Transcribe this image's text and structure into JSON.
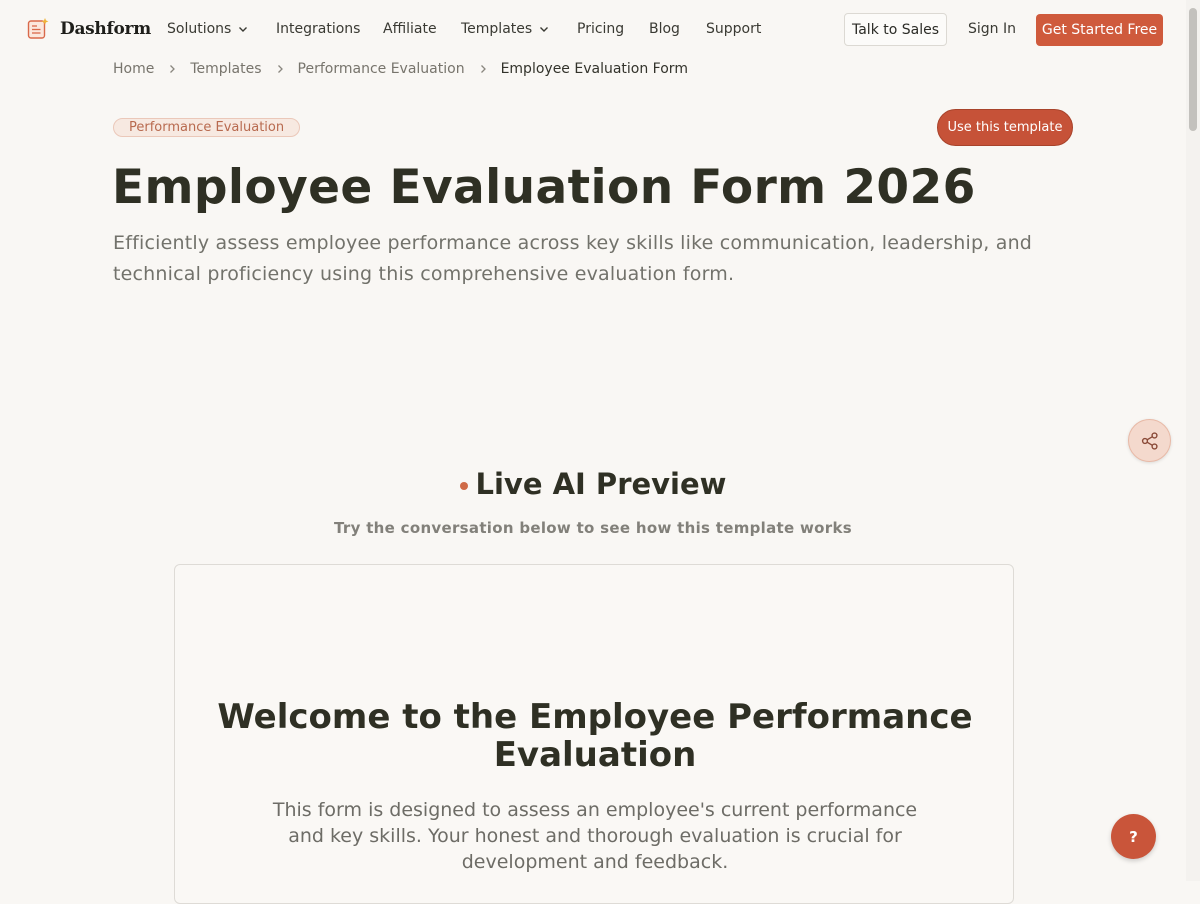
{
  "brand": {
    "name": "Dashform",
    "logo_icon": "form-sparkle-icon"
  },
  "nav": {
    "items": [
      {
        "label": "Solutions",
        "has_dropdown": true
      },
      {
        "label": "Integrations",
        "has_dropdown": false
      },
      {
        "label": "Affiliate",
        "has_dropdown": false
      },
      {
        "label": "Templates",
        "has_dropdown": true
      },
      {
        "label": "Pricing",
        "has_dropdown": false
      },
      {
        "label": "Blog",
        "has_dropdown": false
      },
      {
        "label": "Support",
        "has_dropdown": false
      }
    ],
    "talk_to_sales": "Talk to Sales",
    "sign_in": "Sign In",
    "get_started": "Get Started Free"
  },
  "breadcrumb": [
    "Home",
    "Templates",
    "Performance Evaluation",
    "Employee Evaluation Form"
  ],
  "hero": {
    "category_tag": "Performance Evaluation",
    "use_template": "Use this template",
    "title": "Employee Evaluation Form 2026",
    "description": "Efficiently assess employee performance across key skills like communication, leadership, and technical proficiency using this comprehensive evaluation form."
  },
  "preview": {
    "title": "Live AI Preview",
    "subtitle": "Try the conversation below to see how this template works",
    "welcome_title": "Welcome to the Employee Performance Evaluation",
    "welcome_description": "This form is designed to assess an employee's current performance and key skills. Your honest and thorough evaluation is crucial for development and feedback."
  },
  "floating": {
    "share_icon": "share-icon",
    "help_label": "?"
  },
  "colors": {
    "accent": "#cf5a3c",
    "background": "#f9f7f4",
    "heading": "#2f3024",
    "tag_bg": "#f7e9e1"
  }
}
